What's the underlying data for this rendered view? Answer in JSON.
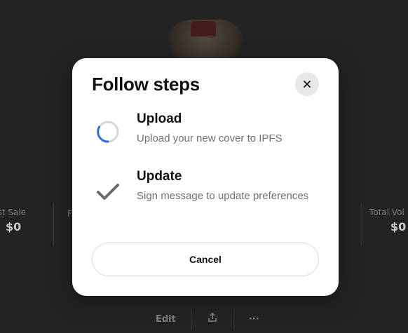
{
  "background": {
    "stats": [
      {
        "label": "ghest Sale",
        "value": "$0"
      },
      {
        "label": "Total Vol",
        "value": "$0"
      }
    ],
    "partial_stat_label": "F",
    "bottom_actions": {
      "edit_label": "Edit",
      "share_icon": "share-icon",
      "more_label": "···"
    }
  },
  "modal": {
    "title": "Follow steps",
    "close_icon": "close-icon",
    "steps": [
      {
        "title": "Upload",
        "description": "Upload your new cover to IPFS",
        "status": "in-progress",
        "icon": "spinner-icon"
      },
      {
        "title": "Update",
        "description": "Sign message to update preferences",
        "status": "complete",
        "icon": "checkmark-icon"
      }
    ],
    "cancel_label": "Cancel"
  },
  "colors": {
    "spinner_accent": "#2f6fe8",
    "spinner_track": "#d6d6d6",
    "check": "#6b6b6b"
  }
}
